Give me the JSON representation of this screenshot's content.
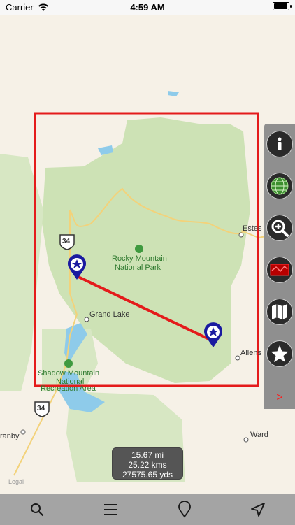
{
  "status_bar": {
    "carrier": "Carrier",
    "time": "4:59 AM"
  },
  "map": {
    "labels": {
      "estes": "Estes",
      "allens": "Allens",
      "grand_lake": "Grand Lake",
      "ward": "Ward",
      "granby": "ranby",
      "park_line1": "Rocky Mountain",
      "park_line2": "National Park",
      "shadow_line1": "Shadow Mountain",
      "shadow_line2": "National",
      "shadow_line3": "Recreation Area",
      "route_34_top": "34",
      "route_34_bottom": "34",
      "legal": "Legal"
    }
  },
  "distance": {
    "miles": "15.67 mi",
    "kms": "25.22 kms",
    "yards": "27575.65 yds"
  },
  "right_panel": {
    "expand_label": ">",
    "tools": [
      "info-icon",
      "globe-icon",
      "zoom-in-icon",
      "map-style-icon",
      "folded-map-icon",
      "star-icon"
    ]
  },
  "toolbar": {
    "items": [
      "search-icon",
      "menu-icon",
      "pin-icon",
      "location-arrow-icon"
    ]
  },
  "colors": {
    "rect": "#e41b1b",
    "line": "#e41b1b",
    "pin": "#1a1aa0",
    "park": "#c9dfb2",
    "water": "#8ecbea"
  }
}
